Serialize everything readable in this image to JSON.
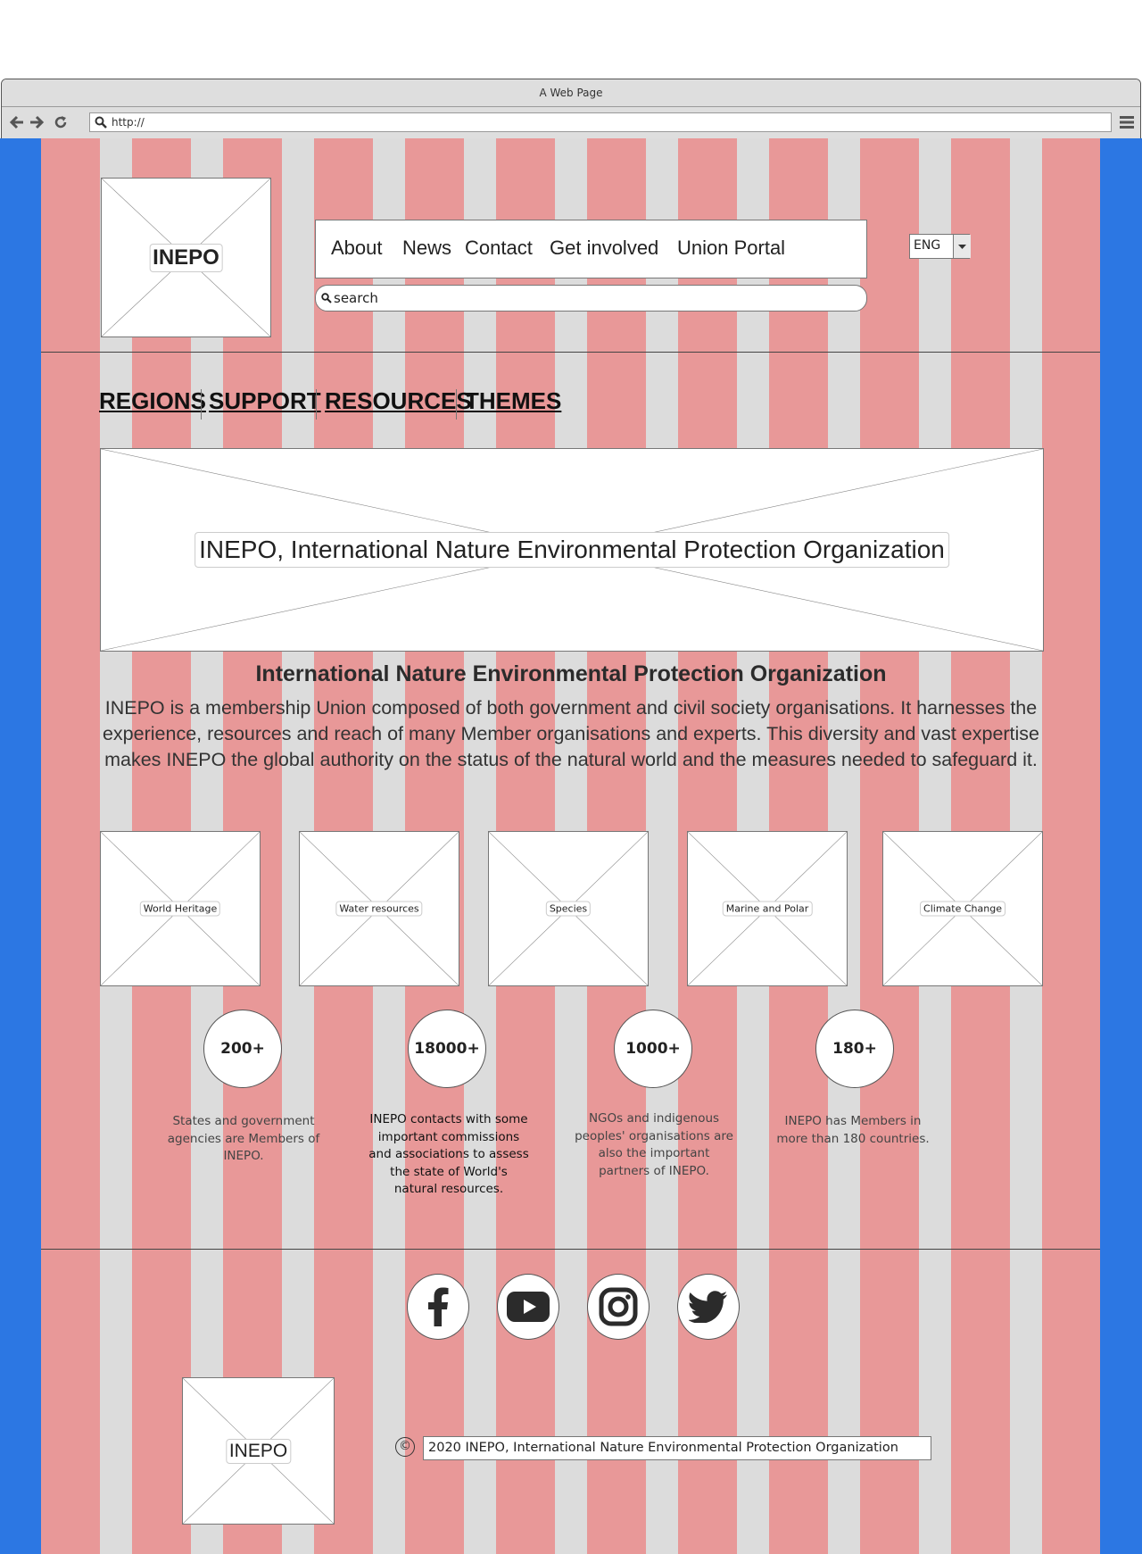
{
  "browser": {
    "window_title": "A Web Page",
    "url": "http://"
  },
  "header": {
    "logo_label": "INEPO",
    "nav": [
      "About",
      "News",
      "Contact",
      "Get involved",
      "Union Portal"
    ],
    "search_placeholder": "search",
    "language": "ENG"
  },
  "tabs": [
    "REGIONS",
    "SUPPORT",
    "RESOURCES",
    "THEMES"
  ],
  "hero": {
    "title": "INEPO, International Nature Environmental Protection Organization"
  },
  "intro": {
    "heading": "International Nature Environmental Protection Organization",
    "body": "INEPO is a membership Union composed of both government and civil society organisations. It harnesses the experience, resources and reach of many Member organisations and experts. This diversity and vast expertise makes INEPO the global authority on the status of the natural world and the measures needed to safeguard it."
  },
  "themes": [
    "World Heritage",
    "Water resources",
    "Species",
    "Marine and Polar",
    "Climate Change"
  ],
  "stats": [
    {
      "value": "200+",
      "text": "States and government agencies are Members of INEPO."
    },
    {
      "value": "18000+",
      "text": "INEPO contacts with some important commissions and associations to assess the state of World's natural resources."
    },
    {
      "value": "1000+",
      "text": "NGOs and indigenous peoples' organisations are also the important partners of INEPO."
    },
    {
      "value": "180+",
      "text": "INEPO has Members in more than 180 countries."
    }
  ],
  "social": [
    "facebook-icon",
    "youtube-icon",
    "instagram-icon",
    "twitter-icon"
  ],
  "footer": {
    "logo_label": "INEPO",
    "copyright_symbol": "©",
    "copyright": "2020 INEPO, International Nature Environmental Protection Organization"
  },
  "colors": {
    "stripe_pink": "#e89898",
    "stripe_gray": "#dcdcdc",
    "side_blue": "#2c77e3"
  }
}
